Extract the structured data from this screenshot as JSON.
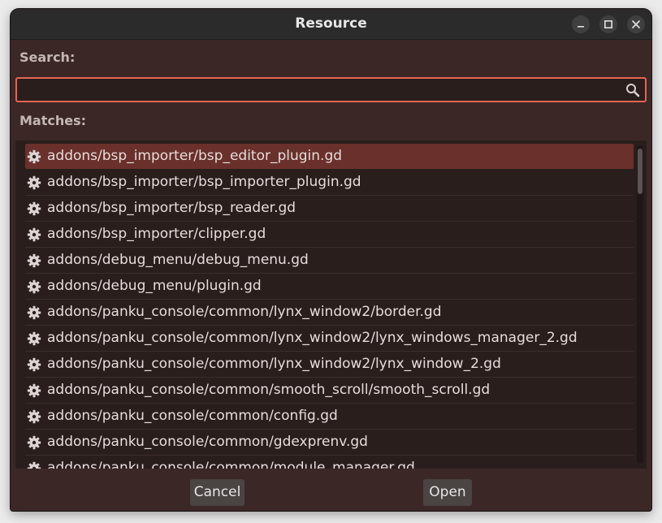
{
  "window": {
    "title": "Resource"
  },
  "search": {
    "label": "Search:",
    "value": "",
    "placeholder": ""
  },
  "matches": {
    "label": "Matches:",
    "items": [
      {
        "icon": "gear-icon",
        "path": "addons/bsp_importer/bsp_editor_plugin.gd",
        "selected": true
      },
      {
        "icon": "gear-icon",
        "path": "addons/bsp_importer/bsp_importer_plugin.gd"
      },
      {
        "icon": "gear-icon",
        "path": "addons/bsp_importer/bsp_reader.gd"
      },
      {
        "icon": "gear-icon",
        "path": "addons/bsp_importer/clipper.gd"
      },
      {
        "icon": "gear-icon",
        "path": "addons/debug_menu/debug_menu.gd"
      },
      {
        "icon": "gear-icon",
        "path": "addons/debug_menu/plugin.gd"
      },
      {
        "icon": "gear-icon",
        "path": "addons/panku_console/common/lynx_window2/border.gd"
      },
      {
        "icon": "gear-icon",
        "path": "addons/panku_console/common/lynx_window2/lynx_windows_manager_2.gd"
      },
      {
        "icon": "gear-icon",
        "path": "addons/panku_console/common/lynx_window2/lynx_window_2.gd"
      },
      {
        "icon": "gear-icon",
        "path": "addons/panku_console/common/smooth_scroll/smooth_scroll.gd"
      },
      {
        "icon": "gear-icon",
        "path": "addons/panku_console/common/config.gd"
      },
      {
        "icon": "gear-icon",
        "path": "addons/panku_console/common/gdexprenv.gd"
      },
      {
        "icon": "gear-icon",
        "path": "addons/panku_console/common/module_manager.gd"
      }
    ]
  },
  "buttons": {
    "cancel": "Cancel",
    "open": "Open"
  },
  "colors": {
    "accent": "#e46552",
    "selection": "#6a302b",
    "panel": "#3b2826",
    "list_bg": "#2a1e1d"
  }
}
